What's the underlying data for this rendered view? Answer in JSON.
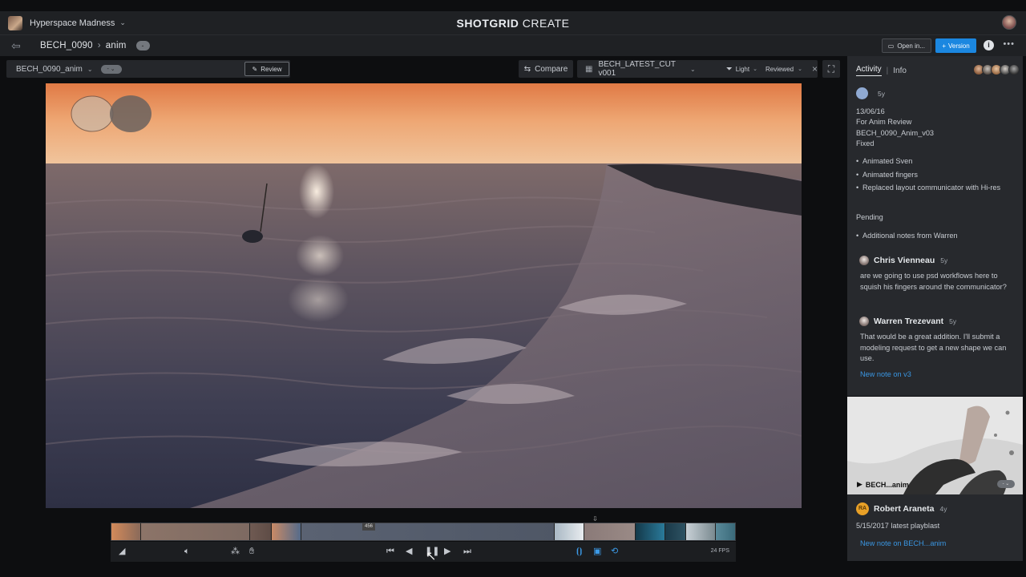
{
  "topbar": {
    "project_name": "Hyperspace Madness",
    "app_title_bold": "SHOTGRID",
    "app_title_rest": " CREATE"
  },
  "navbar": {
    "breadcrumb_shot": "BECH_0090",
    "breadcrumb_sep": "›",
    "breadcrumb_task": "anim",
    "badge": "-",
    "open_in_label": "Open in...",
    "version_label": "Version",
    "info_label": "i",
    "more_label": "•••"
  },
  "viewer_toolbar": {
    "shot_label": "BECH_0090_anim",
    "shot_pill": "- ⌄",
    "review_label": "Review",
    "compare_label": "Compare",
    "playlist_name": "BECH_LATEST_CUT v001",
    "filter_light": "Light",
    "filter_status": "Reviewed"
  },
  "timeline": {
    "frame_marker": "456",
    "fps_label": "24 FPS",
    "clips": [
      {
        "w": 37,
        "c1": "#d38a5a",
        "c2": "#8a6a5a"
      },
      {
        "w": 136,
        "c1": "#8c7468",
        "c2": "#7d6a62"
      },
      {
        "w": 27,
        "c1": "#6f5a52",
        "c2": "#5e4c46"
      },
      {
        "w": 37,
        "c1": "#c98a66",
        "c2": "#556b8a"
      },
      {
        "w": 316,
        "c1": "#5a6272",
        "c2": "#4f5766"
      },
      {
        "w": 37,
        "c1": "#a9b8c4",
        "c2": "#e8ecef"
      },
      {
        "w": 64,
        "c1": "#8a7a78",
        "c2": "#9a8a86"
      },
      {
        "w": 37,
        "c1": "#14394a",
        "c2": "#2a7a9a"
      },
      {
        "w": 26,
        "c1": "#1a3a4a",
        "c2": "#2e5262"
      },
      {
        "w": 37,
        "c1": "#c8d0d6",
        "c2": "#7a8a90"
      },
      {
        "w": 25,
        "c1": "#5a8a9a",
        "c2": "#3a6a7a"
      }
    ]
  },
  "panel": {
    "tab_activity": "Activity",
    "tab_info": "Info",
    "note_age": "5y",
    "note_lines": [
      "13/06/16",
      "For Anim Review",
      "BECH_0090_Anim_v03",
      "Fixed"
    ],
    "fixed_items": [
      "Animated Sven",
      "Animated fingers",
      "Replaced layout communicator with Hi-res"
    ],
    "pending_label": "Pending",
    "pending_items": [
      "Additional notes from Warren"
    ],
    "comments": [
      {
        "name": "Chris Vienneau",
        "age": "5y",
        "body": "are we going to use psd workflows here to squish his fingers around the communicator?"
      },
      {
        "name": "Warren Trezevant",
        "age": "5y",
        "body": "That would be a great addition. I'll submit a modeling request to get a new shape we can use."
      }
    ],
    "new_note_link": "New note on v3"
  },
  "card2": {
    "thumb_label": "BECH...anim",
    "thumb_pill": "- ⌄",
    "author_initials": "RA",
    "author_name": "Robert Araneta",
    "author_age": "4y",
    "text": "5/15/2017 latest playblast",
    "link": "New note on BECH...anim"
  },
  "colors": {
    "accent_blue": "#1b87e0",
    "link_blue": "#3a96e2",
    "panel_bg": "#27292d",
    "bar_bg": "#1f2124"
  }
}
